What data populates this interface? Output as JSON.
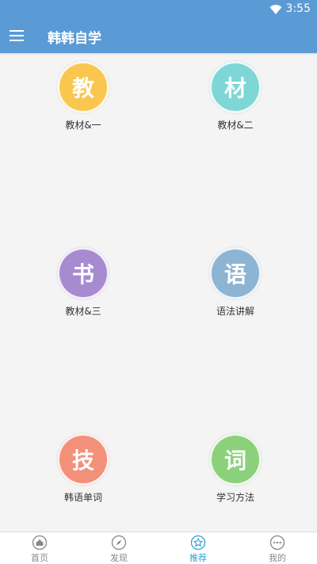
{
  "status": {
    "time": "3:55"
  },
  "appbar": {
    "title": "韩韩自学"
  },
  "tiles": [
    {
      "glyph": "教",
      "label": "教材&一",
      "color": "#f9c74f"
    },
    {
      "glyph": "材",
      "label": "教材&二",
      "color": "#7fd6d6"
    },
    {
      "glyph": "书",
      "label": "教材&三",
      "color": "#a78bd1"
    },
    {
      "glyph": "语",
      "label": "语法讲解",
      "color": "#8eb4d4"
    },
    {
      "glyph": "技",
      "label": "韩语单词",
      "color": "#f3907a"
    },
    {
      "glyph": "词",
      "label": "学习方法",
      "color": "#8bd17c"
    }
  ],
  "tabs": [
    {
      "label": "首页",
      "icon": "home-icon"
    },
    {
      "label": "发现",
      "icon": "compass-icon"
    },
    {
      "label": "推荐",
      "icon": "star-icon",
      "active": true
    },
    {
      "label": "我的",
      "icon": "more-icon"
    }
  ],
  "colors": {
    "primary": "#5b9bd5",
    "active_tab": "#2aa3d6"
  }
}
